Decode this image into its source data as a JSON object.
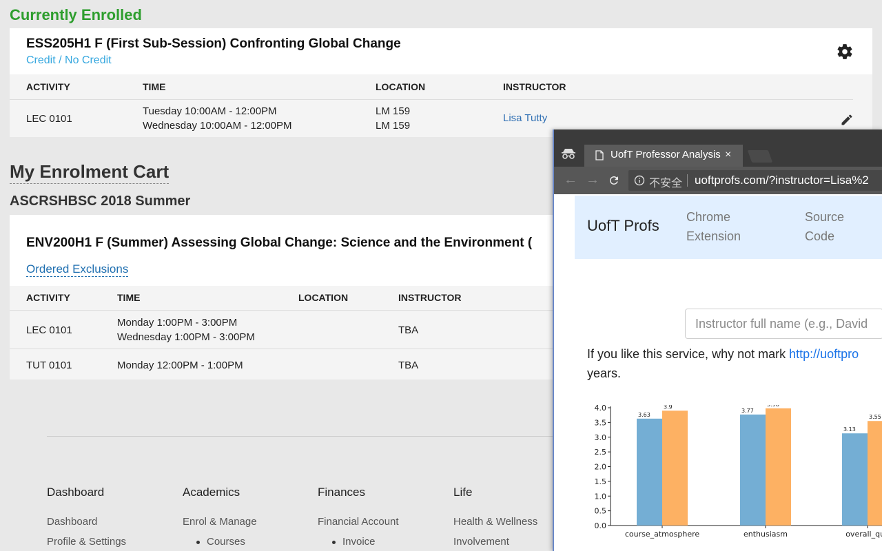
{
  "enrolled": {
    "heading": "Currently Enrolled",
    "course_title": "ESS205H1 F (First Sub-Session) Confronting Global Change",
    "credit_option": "Credit / No Credit",
    "columns": [
      "ACTIVITY",
      "TIME",
      "LOCATION",
      "INSTRUCTOR"
    ],
    "row": {
      "activity": "LEC 0101",
      "time": [
        "Tuesday 10:00AM - 12:00PM",
        "Wednesday 10:00AM - 12:00PM"
      ],
      "location": [
        "LM 159",
        "LM 159"
      ],
      "instructor": "Lisa Tutty"
    }
  },
  "cart": {
    "title": "My Enrolment Cart",
    "session": "ASCRSHBSC 2018 Summer",
    "course_title": "ENV200H1 F (Summer) Assessing Global Change: Science and the Environment (",
    "exclusions_link": "Ordered Exclusions",
    "columns": [
      "ACTIVITY",
      "TIME",
      "LOCATION",
      "INSTRUCTOR"
    ],
    "rows": [
      {
        "activity": "LEC 0101",
        "time": [
          "Monday 1:00PM - 3:00PM",
          "Wednesday 1:00PM - 3:00PM"
        ],
        "location": "",
        "instructor": "TBA"
      },
      {
        "activity": "TUT 0101",
        "time": [
          "Monday 12:00PM - 1:00PM"
        ],
        "location": "",
        "instructor": "TBA"
      }
    ]
  },
  "footer": {
    "columns": [
      {
        "heading": "Dashboard",
        "links": [
          "Dashboard",
          "Profile & Settings"
        ]
      },
      {
        "heading": "Academics",
        "links": [
          "Enrol & Manage"
        ],
        "sub": [
          "Courses"
        ]
      },
      {
        "heading": "Finances",
        "links": [
          "Financial Account"
        ],
        "sub": [
          "Invoice"
        ]
      },
      {
        "heading": "Life",
        "links": [
          "Health & Wellness",
          "Involvement"
        ]
      }
    ]
  },
  "browser": {
    "tab_title": "UofT Professor Analysis",
    "tab_close": "×",
    "security_label": "不安全",
    "url": "uoftprofs.com/?instructor=Lisa%2",
    "site": {
      "brand": "UofT Profs",
      "nav": [
        "Chrome Extension",
        "Source Code"
      ],
      "search_placeholder": "Instructor full name (e.g., David",
      "promo_text": "If you like this service, why not mark ",
      "promo_link": "http://uoftpro",
      "promo_tail": "years."
    }
  },
  "chart_data": {
    "type": "bar",
    "categories": [
      "course_atmosphere",
      "enthusiasm",
      "overall_qua"
    ],
    "series": [
      {
        "values": [
          3.63,
          3.77,
          3.13
        ],
        "color": "#74aed4"
      },
      {
        "values": [
          3.9,
          3.98,
          3.55
        ],
        "color": "#fdb163"
      }
    ],
    "ylim": [
      0,
      4.0
    ],
    "yticks": [
      "0.0",
      "0.5",
      "1.0",
      "1.5",
      "2.0",
      "2.5",
      "3.0",
      "3.5",
      "4.0"
    ],
    "data_labels": [
      [
        "3.63",
        "3.77",
        "3.13"
      ],
      [
        "3.9",
        "3.98",
        "3.55"
      ]
    ]
  }
}
